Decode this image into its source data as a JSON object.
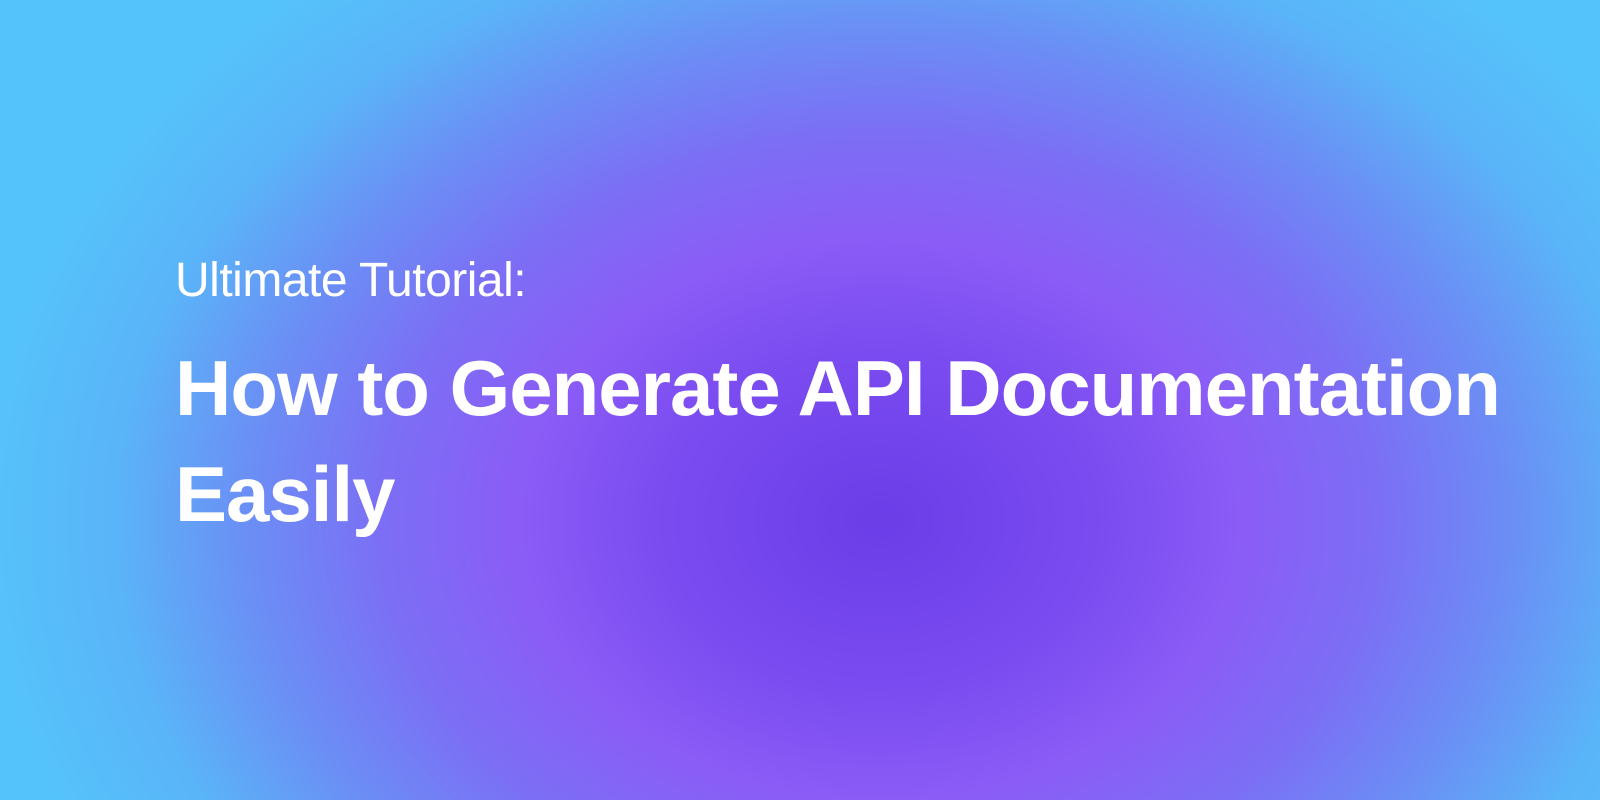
{
  "hero": {
    "subtitle": "Ultimate Tutorial:",
    "title": "How to Generate API Documentation Easily"
  }
}
